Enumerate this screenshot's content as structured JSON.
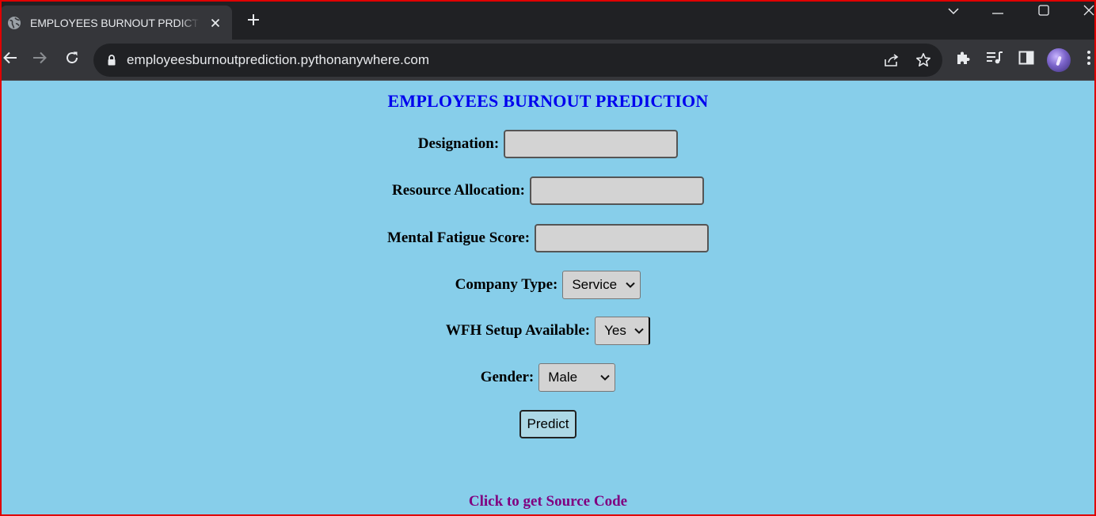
{
  "browser": {
    "tab_title": "EMPLOYEES BURNOUT PRDICTION",
    "url": "employeesburnoutprediction.pythonanywhere.com",
    "icons": {
      "tab": "globe-icon",
      "close": "close-icon",
      "new_tab": "plus-icon",
      "back": "back-arrow-icon",
      "forward": "forward-arrow-icon",
      "reload": "reload-icon",
      "lock": "lock-icon",
      "share": "share-icon",
      "bookmark": "star-icon",
      "extensions": "puzzle-icon",
      "media": "queue-music-icon",
      "side_panel": "side-panel-icon",
      "menu": "kebab-menu-icon"
    }
  },
  "page": {
    "title": "EMPLOYEES BURNOUT PREDICTION",
    "fields": {
      "designation": {
        "label": "Designation:",
        "value": ""
      },
      "resource_allocation": {
        "label": "Resource Allocation:",
        "value": ""
      },
      "mental_fatigue": {
        "label": "Mental Fatigue Score:",
        "value": ""
      },
      "company_type": {
        "label": "Company Type:",
        "selected": "Service"
      },
      "wfh_setup": {
        "label": "WFH Setup Available:",
        "selected": "Yes"
      },
      "gender": {
        "label": "Gender:",
        "selected": "Male"
      }
    },
    "predict_label": "Predict",
    "source_link": "Click to get Source Code"
  },
  "colors": {
    "page_background": "#87ceea",
    "title": "#0000ee",
    "link": "#800080",
    "input_background": "#d3d3d3",
    "button_background": "#add8e6"
  }
}
